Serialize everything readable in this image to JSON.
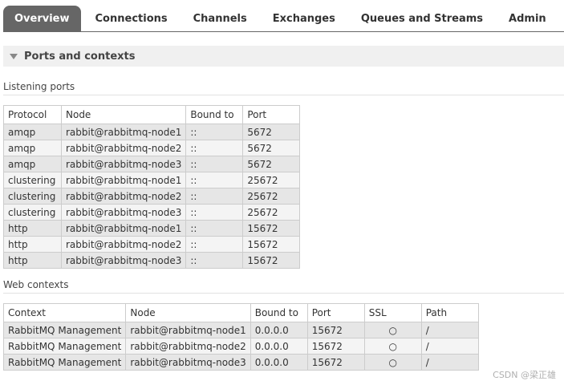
{
  "tabs": [
    {
      "label": "Overview",
      "active": true
    },
    {
      "label": "Connections"
    },
    {
      "label": "Channels"
    },
    {
      "label": "Exchanges"
    },
    {
      "label": "Queues and Streams"
    },
    {
      "label": "Admin"
    }
  ],
  "section": {
    "title": "Ports and contexts"
  },
  "listening_ports": {
    "heading": "Listening ports",
    "columns": [
      "Protocol",
      "Node",
      "Bound to",
      "Port"
    ],
    "rows": [
      [
        "amqp",
        "rabbit@rabbitmq-node1",
        "::",
        "5672"
      ],
      [
        "amqp",
        "rabbit@rabbitmq-node2",
        "::",
        "5672"
      ],
      [
        "amqp",
        "rabbit@rabbitmq-node3",
        "::",
        "5672"
      ],
      [
        "clustering",
        "rabbit@rabbitmq-node1",
        "::",
        "25672"
      ],
      [
        "clustering",
        "rabbit@rabbitmq-node2",
        "::",
        "25672"
      ],
      [
        "clustering",
        "rabbit@rabbitmq-node3",
        "::",
        "25672"
      ],
      [
        "http",
        "rabbit@rabbitmq-node1",
        "::",
        "15672"
      ],
      [
        "http",
        "rabbit@rabbitmq-node2",
        "::",
        "15672"
      ],
      [
        "http",
        "rabbit@rabbitmq-node3",
        "::",
        "15672"
      ]
    ]
  },
  "web_contexts": {
    "heading": "Web contexts",
    "columns": [
      "Context",
      "Node",
      "Bound to",
      "Port",
      "SSL",
      "Path"
    ],
    "rows": [
      [
        "RabbitMQ Management",
        "rabbit@rabbitmq-node1",
        "0.0.0.0",
        "15672",
        "○",
        "/"
      ],
      [
        "RabbitMQ Management",
        "rabbit@rabbitmq-node2",
        "0.0.0.0",
        "15672",
        "○",
        "/"
      ],
      [
        "RabbitMQ Management",
        "rabbit@rabbitmq-node3",
        "0.0.0.0",
        "15672",
        "○",
        "/"
      ]
    ]
  },
  "watermark": "CSDN @梁正雄"
}
